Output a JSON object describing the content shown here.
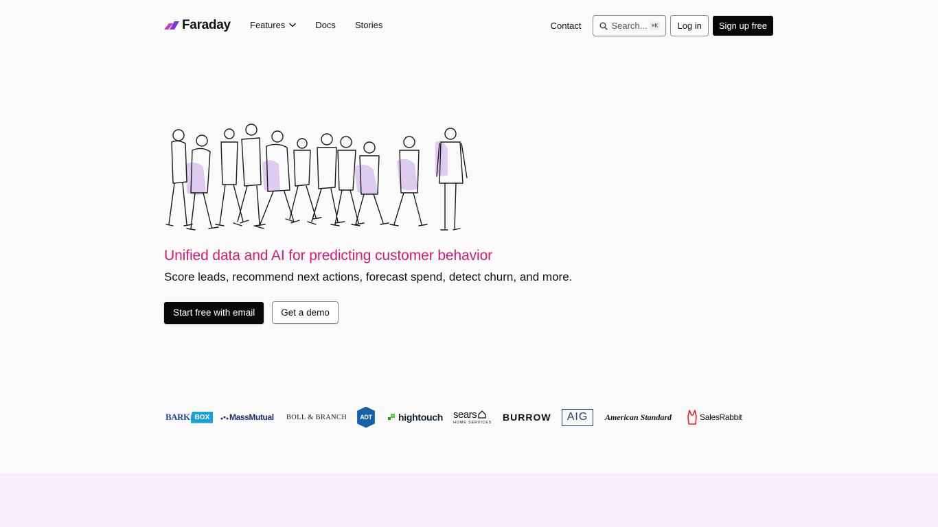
{
  "brand": {
    "name": "Faraday"
  },
  "nav": {
    "links": [
      {
        "label": "Features",
        "has_dropdown": true
      },
      {
        "label": "Docs"
      },
      {
        "label": "Stories"
      }
    ],
    "contact": "Contact",
    "search": {
      "placeholder": "Search...",
      "shortcut": "⌘K"
    },
    "login": "Log in",
    "signup": "Sign up free"
  },
  "hero": {
    "headline": "Unified data and AI for predicting customer behavior",
    "subheadline": "Score leads, recommend next actions, forecast spend, detect churn, and more.",
    "primary_cta": "Start free with email",
    "secondary_cta": "Get a demo"
  },
  "customer_logos": {
    "barkbox": {
      "word1": "BARK",
      "word2": "BOX"
    },
    "massmutual": "MassMutual",
    "bollbranch": "BOLL & BRANCH",
    "adt": "ADT",
    "hightouch": "hightouch",
    "sears": {
      "main": "sears",
      "sub": "HOME SERVICES"
    },
    "burrow": "BURROW",
    "aig": "AIG",
    "americanstandard": "American Standard",
    "salesrabbit": "SalesRabbit"
  },
  "colors": {
    "accent": "#d61a6f",
    "logo_mark": "#c33fd0",
    "illustration_fill": "#d9c4ef",
    "footer_band": "#f6f0fb"
  },
  "icons": [
    "faraday-logo-icon",
    "chevron-down-icon",
    "search-icon",
    "rabbit-icon"
  ]
}
